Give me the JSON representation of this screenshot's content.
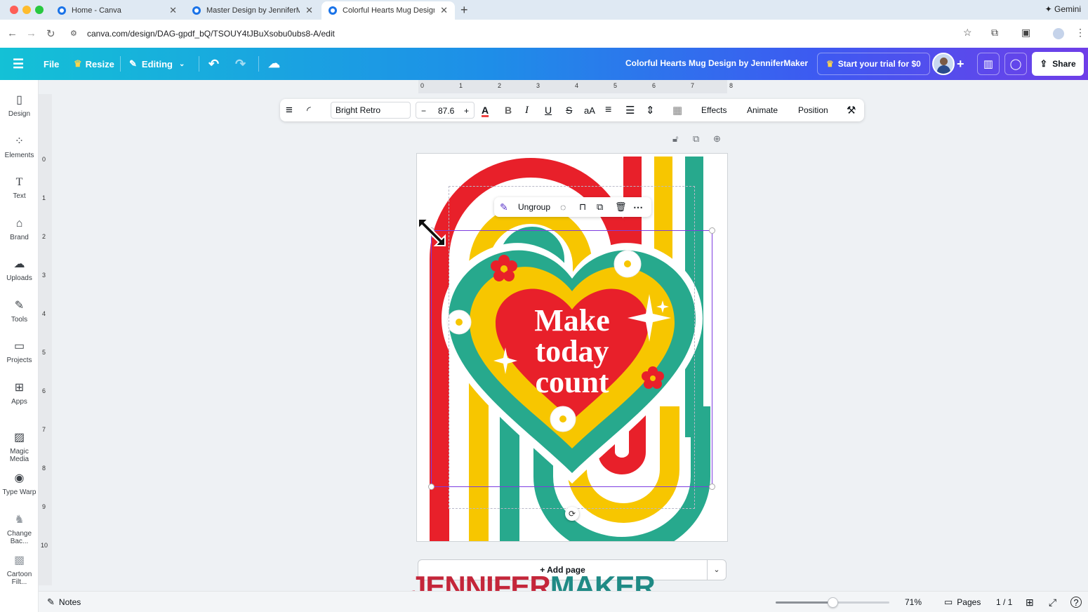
{
  "browser": {
    "tabs": [
      {
        "title": "Home - Canva",
        "active": false
      },
      {
        "title": "Master Design by JenniferMa",
        "active": false
      },
      {
        "title": "Colorful Hearts Mug Design b",
        "active": true
      }
    ],
    "url": "canva.com/design/DAG-gpdf_bQ/TSOUY4tJBuXsobu0ubs8-A/edit",
    "gemini_label": "Gemini"
  },
  "header": {
    "file_label": "File",
    "resize_label": "Resize",
    "editing_label": "Editing",
    "design_title": "Colorful Hearts Mug Design by JenniferMaker",
    "trial_label": "Start your trial for $0",
    "share_label": "Share"
  },
  "sidebar": {
    "items": [
      {
        "label": "Design",
        "icon": "layout-icon"
      },
      {
        "label": "Elements",
        "icon": "shapes-icon"
      },
      {
        "label": "Text",
        "icon": "text-icon"
      },
      {
        "label": "Brand",
        "icon": "brand-icon"
      },
      {
        "label": "Uploads",
        "icon": "cloud-upload-icon"
      },
      {
        "label": "Tools",
        "icon": "pen-icon"
      },
      {
        "label": "Projects",
        "icon": "folder-icon"
      },
      {
        "label": "Apps",
        "icon": "apps-icon"
      },
      {
        "label": "Magic Media",
        "icon": "magic-media-icon"
      },
      {
        "label": "Type Warp",
        "icon": "type-warp-icon"
      },
      {
        "label": "Change Bac...",
        "icon": "change-background-icon"
      },
      {
        "label": "Cartoon Filt...",
        "icon": "cartoon-filter-icon"
      }
    ]
  },
  "rulers": {
    "top_labels": [
      "0",
      "1",
      "2",
      "3",
      "4",
      "5",
      "6",
      "7",
      "8"
    ],
    "left_labels": [
      "0",
      "1",
      "2",
      "3",
      "4",
      "5",
      "6",
      "7",
      "8",
      "9",
      "10"
    ]
  },
  "toolbar": {
    "font_name": "Bright Retro",
    "font_size": "87.6",
    "decrease_label": "−",
    "increase_label": "+",
    "effects_label": "Effects",
    "animate_label": "Animate",
    "position_label": "Position",
    "case_label": "aA"
  },
  "context_menu": {
    "ungroup_label": "Ungroup"
  },
  "design": {
    "text_lines": [
      "Make",
      "today",
      "count"
    ],
    "colors": {
      "red": "#e8202a",
      "yellow": "#f7c600",
      "teal": "#27a98d",
      "white": "#ffffff"
    }
  },
  "add_page_label": "+ Add page",
  "watermark": {
    "part1": "JENNIFER",
    "part2": "MAKER"
  },
  "bottom": {
    "notes_label": "Notes",
    "zoom_label": "71%",
    "zoom_level": 0.5,
    "pages_label": "Pages",
    "page_count": "1 / 1"
  }
}
